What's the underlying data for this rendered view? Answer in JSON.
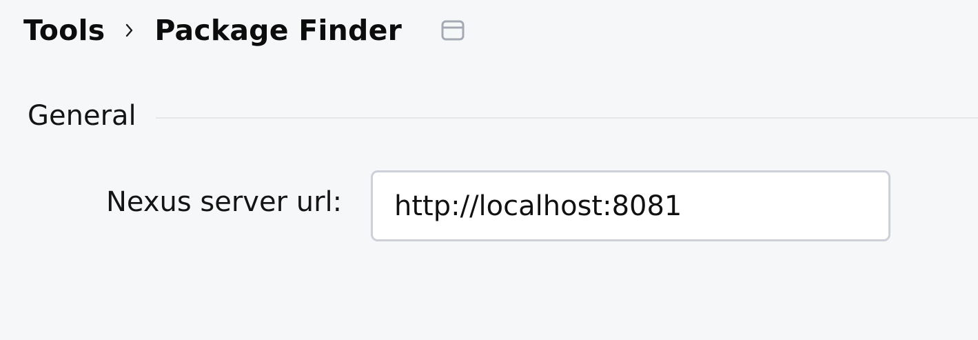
{
  "breadcrumb": {
    "parent": "Tools",
    "separator_icon": "chevron-right-icon",
    "current": "Package Finder",
    "window_icon": "window-icon"
  },
  "section": {
    "title": "General"
  },
  "nexus": {
    "label": "Nexus server url:",
    "value": "http://localhost:8081"
  },
  "colors": {
    "background": "#f6f7f9",
    "input_border": "#cdd0d8",
    "icon": "#a5a9b3"
  }
}
